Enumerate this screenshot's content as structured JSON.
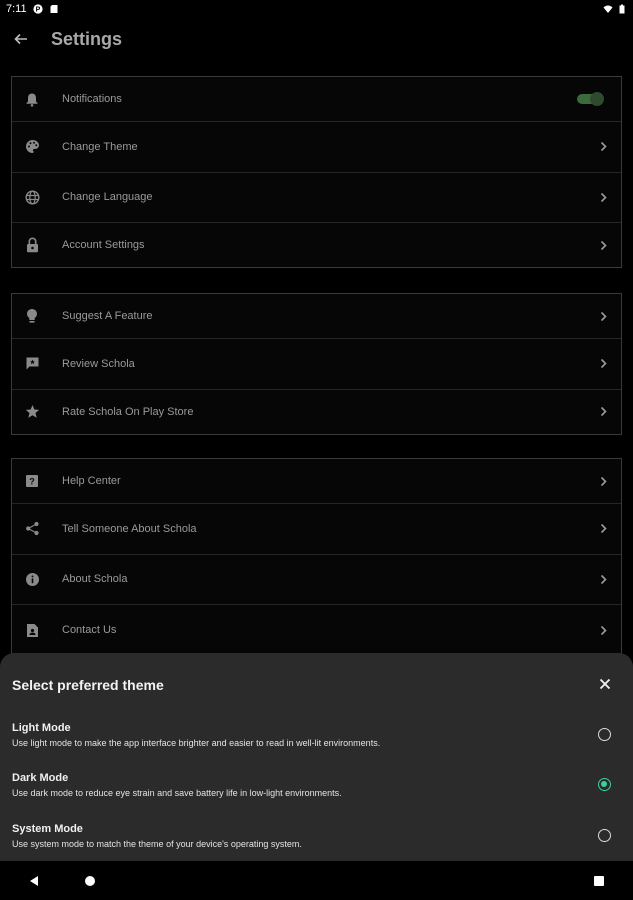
{
  "status_bar": {
    "time": "7:11"
  },
  "app_bar": {
    "title": "Settings"
  },
  "group1": [
    {
      "label": "Notifications",
      "icon": "bell-icon",
      "control": "toggle",
      "toggle_on": true
    },
    {
      "label": "Change Theme",
      "icon": "palette-icon",
      "control": "chevron"
    },
    {
      "label": "Change Language",
      "icon": "globe-icon",
      "control": "chevron"
    },
    {
      "label": "Account Settings",
      "icon": "lock-icon",
      "control": "chevron"
    }
  ],
  "group2": [
    {
      "label": "Suggest A Feature",
      "icon": "lightbulb-icon",
      "control": "chevron"
    },
    {
      "label": "Review Schola",
      "icon": "review-icon",
      "control": "chevron"
    },
    {
      "label": "Rate Schola On Play Store",
      "icon": "star-icon",
      "control": "chevron"
    }
  ],
  "group3": [
    {
      "label": "Help Center",
      "icon": "help-icon",
      "control": "chevron"
    },
    {
      "label": "Tell Someone About Schola",
      "icon": "share-icon",
      "control": "chevron"
    },
    {
      "label": "About Schola",
      "icon": "info-icon",
      "control": "chevron"
    },
    {
      "label": "Contact Us",
      "icon": "contact-icon",
      "control": "chevron"
    }
  ],
  "theme_sheet": {
    "title": "Select preferred theme",
    "options": [
      {
        "title": "Light Mode",
        "description": "Use light mode to make the app interface brighter and easier to read in well-lit environments.",
        "selected": false
      },
      {
        "title": "Dark Mode",
        "description": "Use dark mode to reduce eye strain and save battery life in low-light environments.",
        "selected": true
      },
      {
        "title": "System Mode",
        "description": "Use system mode to match the theme of your device's operating system.",
        "selected": false
      }
    ]
  },
  "colors": {
    "background": "#000000",
    "sheet": "#2b2b2b",
    "accent_radio": "#3fcf9a",
    "toggle_track": "#3b6b3d"
  }
}
